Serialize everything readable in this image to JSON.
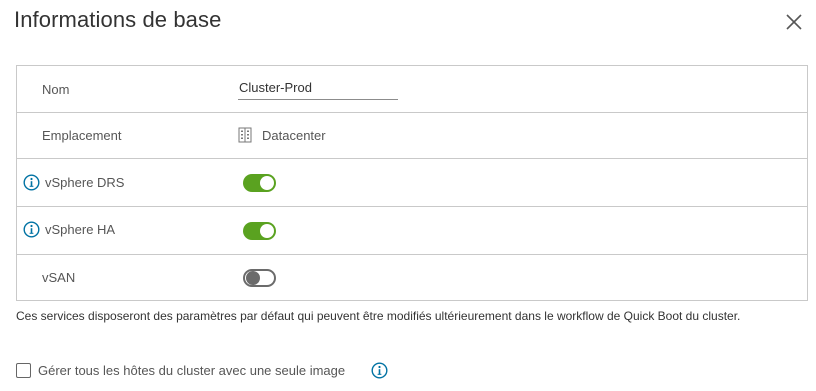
{
  "dialog": {
    "title": "Informations de base",
    "close_icon": "close-icon"
  },
  "fields": {
    "name": {
      "label": "Nom",
      "value": "Cluster-Prod"
    },
    "location": {
      "label": "Emplacement",
      "value": "Datacenter",
      "icon": "datacenter-icon"
    },
    "drs": {
      "label": "vSphere DRS",
      "enabled": true,
      "info_icon": "info-icon"
    },
    "ha": {
      "label": "vSphere HA",
      "enabled": true,
      "info_icon": "info-icon"
    },
    "vsan": {
      "label": "vSAN",
      "enabled": false
    }
  },
  "note": "Ces services disposeront des paramètres par défaut qui peuvent être modifiés ultérieurement dans le workflow de Quick Boot du cluster.",
  "image_option": {
    "label": "Gérer tous les hôtes du cluster avec une seule image",
    "checked": false,
    "info_icon": "info-icon"
  },
  "colors": {
    "toggle_on": "#5aa220",
    "toggle_off_border": "#6b6b6b",
    "info_icon": "#0072a3",
    "border": "#c9c9c9"
  }
}
